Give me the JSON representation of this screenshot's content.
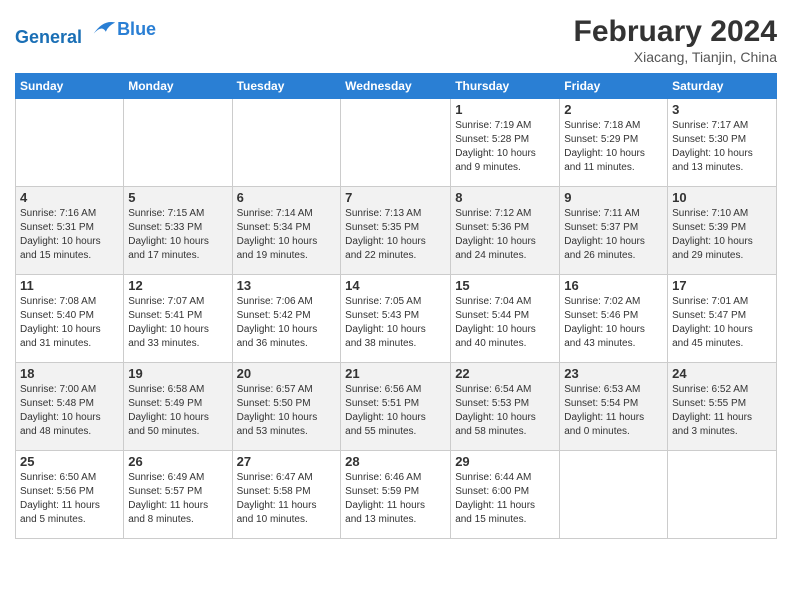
{
  "logo": {
    "line1": "General",
    "line2": "Blue"
  },
  "title": "February 2024",
  "subtitle": "Xiacang, Tianjin, China",
  "weekdays": [
    "Sunday",
    "Monday",
    "Tuesday",
    "Wednesday",
    "Thursday",
    "Friday",
    "Saturday"
  ],
  "weeks": [
    [
      {
        "day": "",
        "info": ""
      },
      {
        "day": "",
        "info": ""
      },
      {
        "day": "",
        "info": ""
      },
      {
        "day": "",
        "info": ""
      },
      {
        "day": "1",
        "info": "Sunrise: 7:19 AM\nSunset: 5:28 PM\nDaylight: 10 hours\nand 9 minutes."
      },
      {
        "day": "2",
        "info": "Sunrise: 7:18 AM\nSunset: 5:29 PM\nDaylight: 10 hours\nand 11 minutes."
      },
      {
        "day": "3",
        "info": "Sunrise: 7:17 AM\nSunset: 5:30 PM\nDaylight: 10 hours\nand 13 minutes."
      }
    ],
    [
      {
        "day": "4",
        "info": "Sunrise: 7:16 AM\nSunset: 5:31 PM\nDaylight: 10 hours\nand 15 minutes."
      },
      {
        "day": "5",
        "info": "Sunrise: 7:15 AM\nSunset: 5:33 PM\nDaylight: 10 hours\nand 17 minutes."
      },
      {
        "day": "6",
        "info": "Sunrise: 7:14 AM\nSunset: 5:34 PM\nDaylight: 10 hours\nand 19 minutes."
      },
      {
        "day": "7",
        "info": "Sunrise: 7:13 AM\nSunset: 5:35 PM\nDaylight: 10 hours\nand 22 minutes."
      },
      {
        "day": "8",
        "info": "Sunrise: 7:12 AM\nSunset: 5:36 PM\nDaylight: 10 hours\nand 24 minutes."
      },
      {
        "day": "9",
        "info": "Sunrise: 7:11 AM\nSunset: 5:37 PM\nDaylight: 10 hours\nand 26 minutes."
      },
      {
        "day": "10",
        "info": "Sunrise: 7:10 AM\nSunset: 5:39 PM\nDaylight: 10 hours\nand 29 minutes."
      }
    ],
    [
      {
        "day": "11",
        "info": "Sunrise: 7:08 AM\nSunset: 5:40 PM\nDaylight: 10 hours\nand 31 minutes."
      },
      {
        "day": "12",
        "info": "Sunrise: 7:07 AM\nSunset: 5:41 PM\nDaylight: 10 hours\nand 33 minutes."
      },
      {
        "day": "13",
        "info": "Sunrise: 7:06 AM\nSunset: 5:42 PM\nDaylight: 10 hours\nand 36 minutes."
      },
      {
        "day": "14",
        "info": "Sunrise: 7:05 AM\nSunset: 5:43 PM\nDaylight: 10 hours\nand 38 minutes."
      },
      {
        "day": "15",
        "info": "Sunrise: 7:04 AM\nSunset: 5:44 PM\nDaylight: 10 hours\nand 40 minutes."
      },
      {
        "day": "16",
        "info": "Sunrise: 7:02 AM\nSunset: 5:46 PM\nDaylight: 10 hours\nand 43 minutes."
      },
      {
        "day": "17",
        "info": "Sunrise: 7:01 AM\nSunset: 5:47 PM\nDaylight: 10 hours\nand 45 minutes."
      }
    ],
    [
      {
        "day": "18",
        "info": "Sunrise: 7:00 AM\nSunset: 5:48 PM\nDaylight: 10 hours\nand 48 minutes."
      },
      {
        "day": "19",
        "info": "Sunrise: 6:58 AM\nSunset: 5:49 PM\nDaylight: 10 hours\nand 50 minutes."
      },
      {
        "day": "20",
        "info": "Sunrise: 6:57 AM\nSunset: 5:50 PM\nDaylight: 10 hours\nand 53 minutes."
      },
      {
        "day": "21",
        "info": "Sunrise: 6:56 AM\nSunset: 5:51 PM\nDaylight: 10 hours\nand 55 minutes."
      },
      {
        "day": "22",
        "info": "Sunrise: 6:54 AM\nSunset: 5:53 PM\nDaylight: 10 hours\nand 58 minutes."
      },
      {
        "day": "23",
        "info": "Sunrise: 6:53 AM\nSunset: 5:54 PM\nDaylight: 11 hours\nand 0 minutes."
      },
      {
        "day": "24",
        "info": "Sunrise: 6:52 AM\nSunset: 5:55 PM\nDaylight: 11 hours\nand 3 minutes."
      }
    ],
    [
      {
        "day": "25",
        "info": "Sunrise: 6:50 AM\nSunset: 5:56 PM\nDaylight: 11 hours\nand 5 minutes."
      },
      {
        "day": "26",
        "info": "Sunrise: 6:49 AM\nSunset: 5:57 PM\nDaylight: 11 hours\nand 8 minutes."
      },
      {
        "day": "27",
        "info": "Sunrise: 6:47 AM\nSunset: 5:58 PM\nDaylight: 11 hours\nand 10 minutes."
      },
      {
        "day": "28",
        "info": "Sunrise: 6:46 AM\nSunset: 5:59 PM\nDaylight: 11 hours\nand 13 minutes."
      },
      {
        "day": "29",
        "info": "Sunrise: 6:44 AM\nSunset: 6:00 PM\nDaylight: 11 hours\nand 15 minutes."
      },
      {
        "day": "",
        "info": ""
      },
      {
        "day": "",
        "info": ""
      }
    ]
  ]
}
